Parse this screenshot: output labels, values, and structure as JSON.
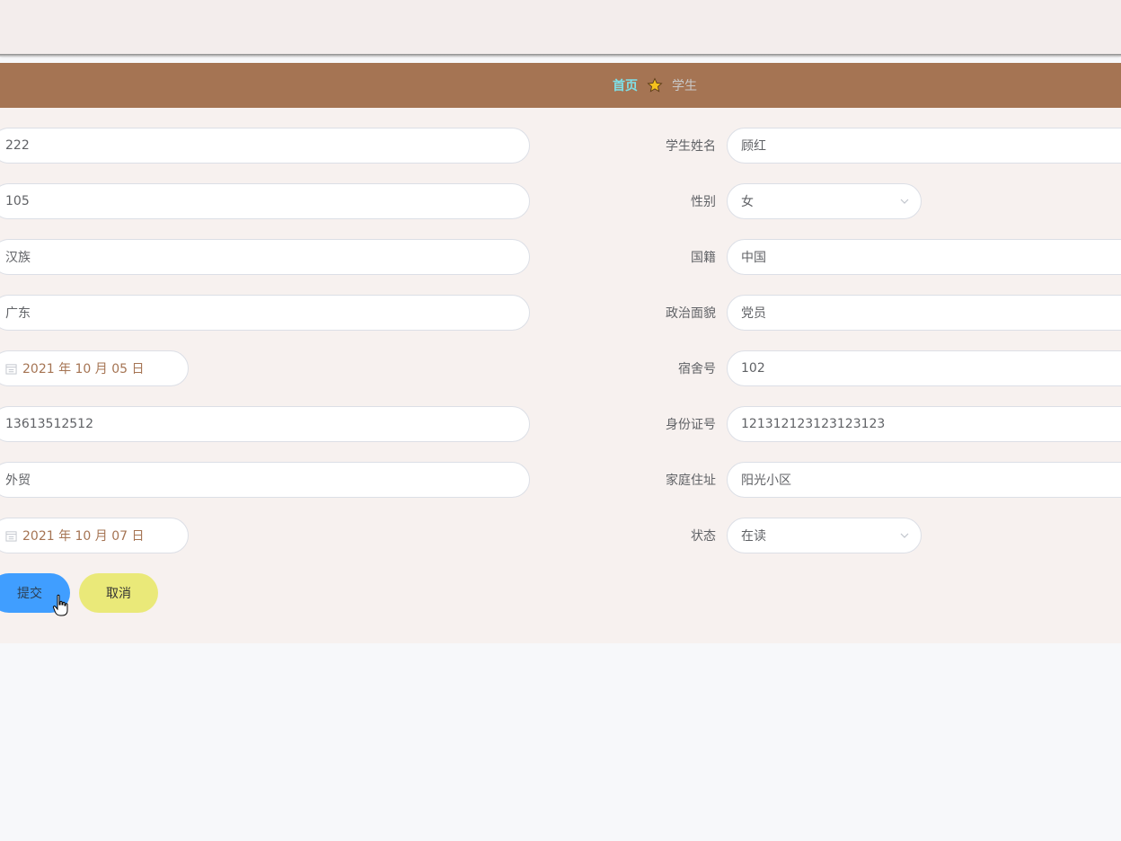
{
  "breadcrumb": {
    "home": "首页",
    "current": "学生"
  },
  "form": {
    "left_fields": [
      {
        "value": "222"
      },
      {
        "value": "105"
      },
      {
        "value": "汉族"
      },
      {
        "value": "广东"
      },
      {
        "value": "2021 年 10 月 05 日",
        "type": "date"
      },
      {
        "value": "13613512512"
      },
      {
        "value": "外贸"
      },
      {
        "value": "2021 年 10 月 07 日",
        "type": "date"
      }
    ],
    "right_fields": [
      {
        "label": "学生姓名",
        "value": "顾红"
      },
      {
        "label": "性别",
        "value": "女",
        "type": "select"
      },
      {
        "label": "国籍",
        "value": "中国"
      },
      {
        "label": "政治面貌",
        "value": "党员"
      },
      {
        "label": "宿舍号",
        "value": "102"
      },
      {
        "label": "身份证号",
        "value": "121312123123123123"
      },
      {
        "label": "家庭住址",
        "value": "阳光小区"
      },
      {
        "label": "状态",
        "value": "在读",
        "type": "select"
      }
    ]
  },
  "buttons": {
    "submit": "提交",
    "cancel": "取消"
  },
  "colors": {
    "primary": "#409eff",
    "cancel": "#eae979",
    "breadcrumb_bg": "#a57453",
    "accent": "#7ee0e8"
  },
  "icons": {
    "separator": "star-icon",
    "date": "calendar-icon",
    "select": "chevron-down-icon",
    "cursor": "hand-cursor-icon"
  }
}
